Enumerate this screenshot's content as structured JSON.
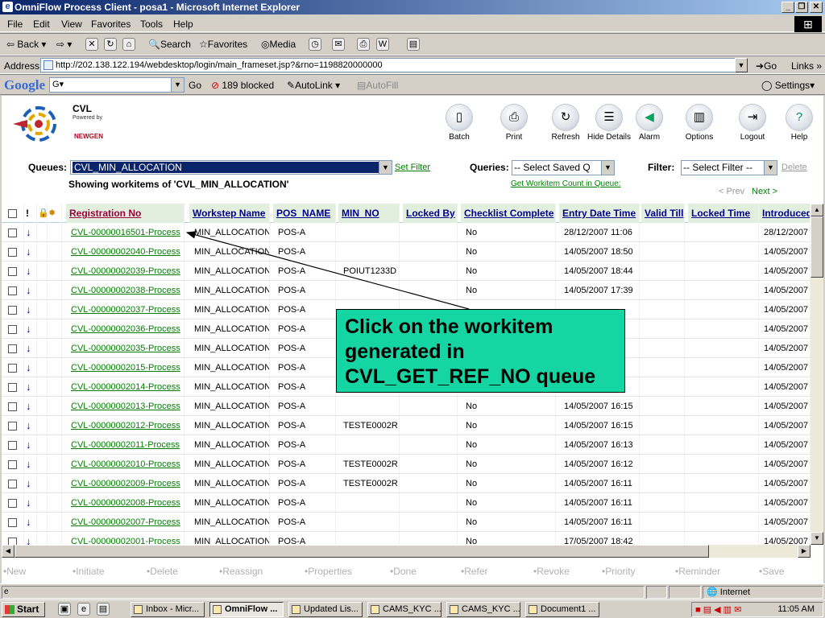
{
  "window": {
    "title": "OmniFlow Process Client - posa1 - Microsoft Internet Explorer"
  },
  "menu": [
    "File",
    "Edit",
    "View",
    "Favorites",
    "Tools",
    "Help"
  ],
  "toolbar": {
    "back": "Back",
    "search": "Search",
    "favorites": "Favorites",
    "media": "Media"
  },
  "address": {
    "label": "Address",
    "url": "http://202.138.122.194/webdesktop/login/main_frameset.jsp?&rno=1198820000000",
    "go": "Go",
    "links": "Links"
  },
  "googlebar": {
    "brand": "Google",
    "search_value": "G",
    "go": "Go",
    "blocked": "189 blocked",
    "autolink": "AutoLink",
    "autofill": "AutoFill",
    "settings": "Settings"
  },
  "logo": {
    "name": "CVL",
    "powered": "Powered by",
    "vendor": "NEWGEN"
  },
  "app_toolbar": [
    {
      "label": "Batch",
      "icon": "batch-icon"
    },
    {
      "label": "Print",
      "icon": "print-icon"
    },
    {
      "label": "Refresh",
      "icon": "refresh-icon"
    },
    {
      "label": "Hide Details",
      "icon": "hide-details-icon"
    },
    {
      "label": "Alarm",
      "icon": "alarm-icon"
    },
    {
      "label": "Options",
      "icon": "options-icon"
    },
    {
      "label": "Logout",
      "icon": "logout-icon"
    },
    {
      "label": "Help",
      "icon": "help-icon"
    }
  ],
  "queues": {
    "label": "Queues:",
    "selected": "CVL_MIN_ALLOCATION",
    "set_filter": "Set Filter",
    "showing": "Showing workitems of 'CVL_MIN_ALLOCATION'",
    "queries_label": "Queries:",
    "queries_value": "-- Select Saved Q",
    "filter_label": "Filter:",
    "filter_value": "-- Select Filter --",
    "delete": "Delete",
    "count_link": "Get Workitem Count in Queue:",
    "prev": "< Prev",
    "next": "Next >"
  },
  "table": {
    "headers": [
      "Registration No",
      "Workstep Name",
      "POS_NAME",
      "MIN_NO",
      "Locked By",
      "Checklist Complete",
      "Entry Date Time",
      "Valid Till",
      "Locked Time",
      "Introduced"
    ],
    "rows": [
      [
        "CVL-00000016501-Process",
        "MIN_ALLOCATION",
        "POS-A",
        "",
        "",
        "No",
        "28/12/2007 11:06",
        "",
        "",
        "28/12/2007"
      ],
      [
        "CVL-00000002040-Process",
        "MIN_ALLOCATION",
        "POS-A",
        "",
        "",
        "No",
        "14/05/2007 18:50",
        "",
        "",
        "14/05/2007"
      ],
      [
        "CVL-00000002039-Process",
        "MIN_ALLOCATION",
        "POS-A",
        "POIUT1233D",
        "",
        "No",
        "14/05/2007 18:44",
        "",
        "",
        "14/05/2007"
      ],
      [
        "CVL-00000002038-Process",
        "MIN_ALLOCATION",
        "POS-A",
        "",
        "",
        "No",
        "14/05/2007 17:39",
        "",
        "",
        "14/05/2007"
      ],
      [
        "CVL-00000002037-Process",
        "MIN_ALLOCATION",
        "POS-A",
        "",
        "",
        "",
        "",
        "",
        "",
        "14/05/2007"
      ],
      [
        "CVL-00000002036-Process",
        "MIN_ALLOCATION",
        "POS-A",
        "",
        "",
        "",
        "",
        "",
        "",
        "14/05/2007"
      ],
      [
        "CVL-00000002035-Process",
        "MIN_ALLOCATION",
        "POS-A",
        "",
        "",
        "",
        "",
        "",
        "",
        "14/05/2007"
      ],
      [
        "CVL-00000002015-Process",
        "MIN_ALLOCATION",
        "POS-A",
        "",
        "",
        "",
        "",
        "",
        "",
        "14/05/2007"
      ],
      [
        "CVL-00000002014-Process",
        "MIN_ALLOCATION",
        "POS-A",
        "",
        "",
        "",
        "",
        "",
        "",
        "14/05/2007"
      ],
      [
        "CVL-00000002013-Process",
        "MIN_ALLOCATION",
        "POS-A",
        "",
        "",
        "No",
        "14/05/2007 16:15",
        "",
        "",
        "14/05/2007"
      ],
      [
        "CVL-00000002012-Process",
        "MIN_ALLOCATION",
        "POS-A",
        "TESTE0002R",
        "",
        "No",
        "14/05/2007 16:15",
        "",
        "",
        "14/05/2007"
      ],
      [
        "CVL-00000002011-Process",
        "MIN_ALLOCATION",
        "POS-A",
        "",
        "",
        "No",
        "14/05/2007 16:13",
        "",
        "",
        "14/05/2007"
      ],
      [
        "CVL-00000002010-Process",
        "MIN_ALLOCATION",
        "POS-A",
        "TESTE0002R",
        "",
        "No",
        "14/05/2007 16:12",
        "",
        "",
        "14/05/2007"
      ],
      [
        "CVL-00000002009-Process",
        "MIN_ALLOCATION",
        "POS-A",
        "TESTE0002R",
        "",
        "No",
        "14/05/2007 16:11",
        "",
        "",
        "14/05/2007"
      ],
      [
        "CVL-00000002008-Process",
        "MIN_ALLOCATION",
        "POS-A",
        "",
        "",
        "No",
        "14/05/2007 16:11",
        "",
        "",
        "14/05/2007"
      ],
      [
        "CVL-00000002007-Process",
        "MIN_ALLOCATION",
        "POS-A",
        "",
        "",
        "No",
        "14/05/2007 16:11",
        "",
        "",
        "14/05/2007"
      ],
      [
        "CVL-00000002001-Process",
        "MIN_ALLOCATION",
        "POS-A",
        "",
        "",
        "No",
        "17/05/2007 18:42",
        "",
        "",
        "14/05/2007"
      ]
    ]
  },
  "actions": [
    "New",
    "Initiate",
    "Delete",
    "Reassign",
    "Properties",
    "Done",
    "Refer",
    "Revoke",
    "Priority",
    "Reminder",
    "Save"
  ],
  "callout": "Click on the workitem generated in CVL_GET_REF_NO queue",
  "statusbar": {
    "zone": "Internet"
  },
  "taskbar": {
    "start": "Start",
    "tasks": [
      "Inbox - Micr...",
      "OmniFlow ...",
      "Updated Lis...",
      "CAMS_KYC ...",
      "CAMS_KYC ...",
      "Document1 ..."
    ],
    "clock": "11:05 AM"
  }
}
